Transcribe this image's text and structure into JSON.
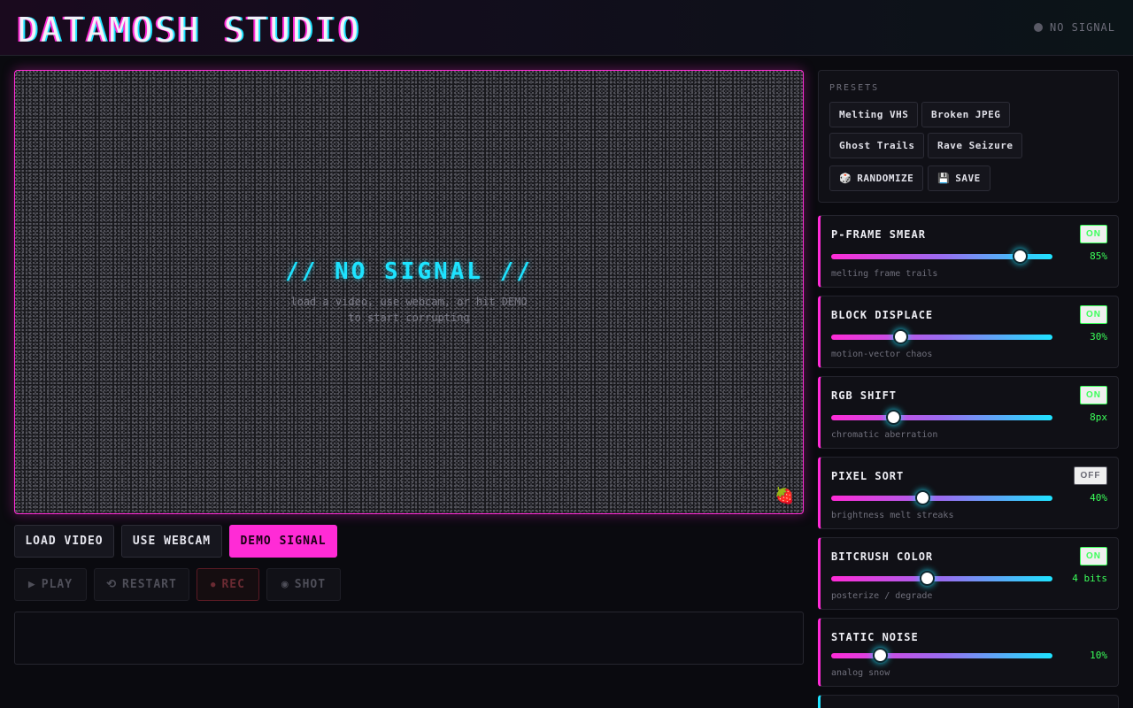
{
  "header": {
    "title": "DATAMOSH STUDIO",
    "status": "NO SIGNAL"
  },
  "viewer": {
    "heading": "// NO SIGNAL //",
    "hint_line1": "load a video, use webcam, or hit DEMO",
    "hint_line2": "to start corrupting",
    "mascot_icon": "strawberry-icon"
  },
  "sources": {
    "load": "LOAD VIDEO",
    "webcam": "USE WEBCAM",
    "demo": "DEMO SIGNAL"
  },
  "transport": {
    "play": "PLAY",
    "play_icon": "▶",
    "restart": "RESTART",
    "restart_icon": "⟲",
    "rec": "REC",
    "rec_icon": "●",
    "shot": "SHOT",
    "shot_icon": "◉"
  },
  "presets": {
    "title": "PRESETS",
    "items": [
      "Melting VHS",
      "Broken JPEG",
      "Ghost Trails",
      "Rave Seizure"
    ],
    "randomize": "RANDOMIZE",
    "randomize_icon": "🎲",
    "save": "SAVE",
    "save_icon": "💾"
  },
  "effects": [
    {
      "name": "P-FRAME SMEAR",
      "toggle": "ON",
      "enabled": true,
      "value": "85%",
      "level": 0.85,
      "desc": "melting frame trails"
    },
    {
      "name": "BLOCK DISPLACE",
      "toggle": "ON",
      "enabled": true,
      "value": "30%",
      "level": 0.31,
      "desc": "motion-vector chaos"
    },
    {
      "name": "RGB SHIFT",
      "toggle": "ON",
      "enabled": true,
      "value": "8px",
      "level": 0.28,
      "desc": "chromatic aberration"
    },
    {
      "name": "PIXEL SORT",
      "toggle": "OFF",
      "enabled": false,
      "value": "40%",
      "level": 0.41,
      "desc": "brightness melt streaks"
    },
    {
      "name": "BITCRUSH COLOR",
      "toggle": "ON",
      "enabled": true,
      "value": "4 bits",
      "level": 0.43,
      "desc": "posterize / degrade"
    },
    {
      "name": "STATIC NOISE",
      "value": "10%",
      "level": 0.22,
      "desc": "analog snow"
    }
  ],
  "colors": {
    "magenta": "#ff2bd6",
    "cyan": "#1ee3ff",
    "green": "#3bff5a",
    "background": "#0a0a0f"
  }
}
